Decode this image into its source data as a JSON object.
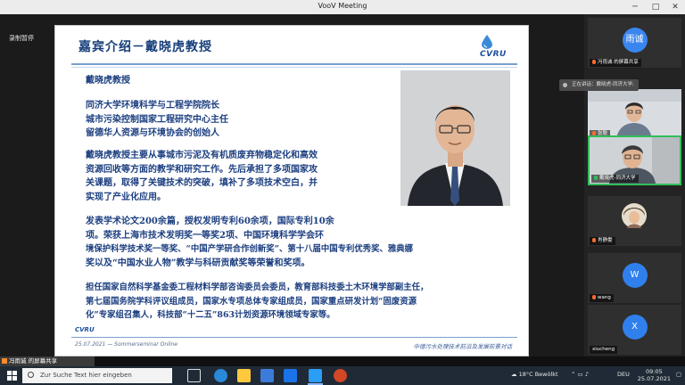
{
  "window": {
    "title": "VooV Meeting"
  },
  "recording": {
    "label": "录制暂停"
  },
  "slide": {
    "title": "嘉宾介绍－戴晓虎教授",
    "logo_text": "CVRU",
    "name_line": "戴晓虎教授",
    "roles": [
      "同济大学环境科学与工程学院院长",
      "城市污染控制国家工程研究中心主任",
      "留德华人资源与环境协会的创始人"
    ],
    "research_lines": [
      "戴晓虎教授主要从事城市污泥及有机质废弃物稳定化和高效",
      "资源回收等方面的教学和研究工作。先后承担了多项国家攻",
      "关课题，取得了关键技术的突破，填补了多项技术空白，并",
      "实现了产业化应用。"
    ],
    "achievement_lines": [
      "发表学术论文200余篇，授权发明专利60余项，国际专利10余",
      "项。荣获上海市技术发明奖一等奖2项、中国环境科学学会环",
      "境保护科学技术奖一等奖、“中国产学研合作创新奖”、第十八届中国专利优秀奖、雅典娜",
      "奖以及“中国水业人物”教学与科研贡献奖等荣誉和奖项。"
    ],
    "service_lines": [
      "担任国家自然科学基金委工程材料学部咨询委员会委员，教育部科技委土木环境学部副主任，",
      "第七届国务院学科评议组成员，国家水专项总体专家组成员，国家重点研发计划“固废资源",
      "化”专家组召集人，科技部“十二五”863计划资源环境领域专家等。"
    ],
    "footer_brand": "CVRU",
    "footer_date": "25.07.2021 — Sommerseminar Online",
    "footer_right": "中德污水处理技术前沿及发展前景对话"
  },
  "participants": [
    {
      "name": "冯雨诚 的屏幕共享",
      "avatar_text": "雨诚",
      "type": "avatar"
    },
    {
      "name": "张聪",
      "type": "video"
    },
    {
      "name": "戴晓虎-同济大学",
      "type": "video",
      "active": true
    },
    {
      "name": "肖静雯",
      "type": "video"
    },
    {
      "name": "wang",
      "avatar_text": "W",
      "type": "avatar"
    },
    {
      "name": "xiucheng",
      "avatar_text": "X",
      "type": "avatar"
    }
  ],
  "speaking": {
    "label": "正在讲话：戴晓虎-同济大学;"
  },
  "share_status": {
    "label": "冯雨诚 的屏幕共享"
  },
  "taskbar": {
    "search_placeholder": "Zur Suche Text hier eingeben",
    "weather": "18°C  Bewölkt",
    "lang": "DEU",
    "time": "09:05",
    "date": "25.07.2021"
  },
  "colors": {
    "accent_green": "#2fbf5a",
    "avatar_blue": "#2f80ed",
    "slide_text": "#1c3f80"
  }
}
